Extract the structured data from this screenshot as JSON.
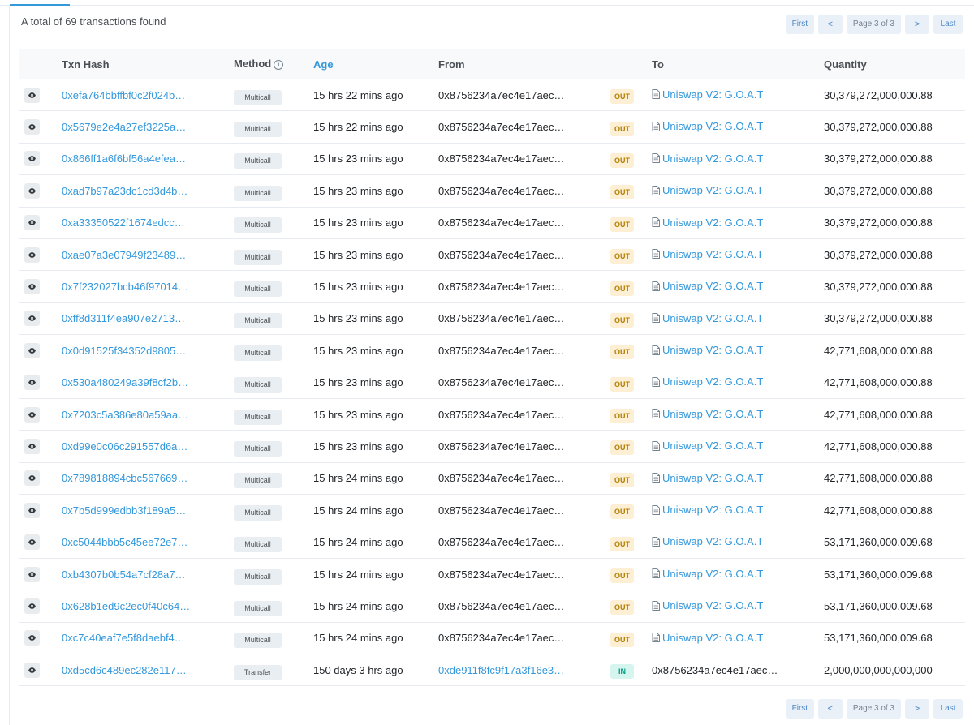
{
  "summary": "A total of 69 transactions found",
  "pager": {
    "first": "First",
    "prev": "<",
    "info": "Page 3 of 3",
    "next": ">",
    "last": "Last"
  },
  "table": {
    "headers": {
      "hash": "Txn Hash",
      "method": "Method",
      "age": "Age",
      "from": "From",
      "to": "To",
      "quantity": "Quantity"
    },
    "rows": [
      {
        "hash": "0xefa764bbffbf0c2f024b…",
        "method": "Multicall",
        "age": "15 hrs 22 mins ago",
        "from": "0x8756234a7ec4e17aec…",
        "dir": "OUT",
        "to": "Uniswap V2: G.O.A.T",
        "to_contract": true,
        "qty": "30,379,272,000,000.88"
      },
      {
        "hash": "0x5679e2e4a27ef3225a…",
        "method": "Multicall",
        "age": "15 hrs 22 mins ago",
        "from": "0x8756234a7ec4e17aec…",
        "dir": "OUT",
        "to": "Uniswap V2: G.O.A.T",
        "to_contract": true,
        "qty": "30,379,272,000,000.88"
      },
      {
        "hash": "0x866ff1a6f6bf56a4efea…",
        "method": "Multicall",
        "age": "15 hrs 23 mins ago",
        "from": "0x8756234a7ec4e17aec…",
        "dir": "OUT",
        "to": "Uniswap V2: G.O.A.T",
        "to_contract": true,
        "qty": "30,379,272,000,000.88"
      },
      {
        "hash": "0xad7b97a23dc1cd3d4b…",
        "method": "Multicall",
        "age": "15 hrs 23 mins ago",
        "from": "0x8756234a7ec4e17aec…",
        "dir": "OUT",
        "to": "Uniswap V2: G.O.A.T",
        "to_contract": true,
        "qty": "30,379,272,000,000.88"
      },
      {
        "hash": "0xa33350522f1674edcc…",
        "method": "Multicall",
        "age": "15 hrs 23 mins ago",
        "from": "0x8756234a7ec4e17aec…",
        "dir": "OUT",
        "to": "Uniswap V2: G.O.A.T",
        "to_contract": true,
        "qty": "30,379,272,000,000.88"
      },
      {
        "hash": "0xae07a3e07949f23489…",
        "method": "Multicall",
        "age": "15 hrs 23 mins ago",
        "from": "0x8756234a7ec4e17aec…",
        "dir": "OUT",
        "to": "Uniswap V2: G.O.A.T",
        "to_contract": true,
        "qty": "30,379,272,000,000.88"
      },
      {
        "hash": "0x7f232027bcb46f97014…",
        "method": "Multicall",
        "age": "15 hrs 23 mins ago",
        "from": "0x8756234a7ec4e17aec…",
        "dir": "OUT",
        "to": "Uniswap V2: G.O.A.T",
        "to_contract": true,
        "qty": "30,379,272,000,000.88"
      },
      {
        "hash": "0xff8d311f4ea907e2713…",
        "method": "Multicall",
        "age": "15 hrs 23 mins ago",
        "from": "0x8756234a7ec4e17aec…",
        "dir": "OUT",
        "to": "Uniswap V2: G.O.A.T",
        "to_contract": true,
        "qty": "30,379,272,000,000.88"
      },
      {
        "hash": "0x0d91525f34352d9805…",
        "method": "Multicall",
        "age": "15 hrs 23 mins ago",
        "from": "0x8756234a7ec4e17aec…",
        "dir": "OUT",
        "to": "Uniswap V2: G.O.A.T",
        "to_contract": true,
        "qty": "42,771,608,000,000.88"
      },
      {
        "hash": "0x530a480249a39f8cf2b…",
        "method": "Multicall",
        "age": "15 hrs 23 mins ago",
        "from": "0x8756234a7ec4e17aec…",
        "dir": "OUT",
        "to": "Uniswap V2: G.O.A.T",
        "to_contract": true,
        "qty": "42,771,608,000,000.88"
      },
      {
        "hash": "0x7203c5a386e80a59aa…",
        "method": "Multicall",
        "age": "15 hrs 23 mins ago",
        "from": "0x8756234a7ec4e17aec…",
        "dir": "OUT",
        "to": "Uniswap V2: G.O.A.T",
        "to_contract": true,
        "qty": "42,771,608,000,000.88"
      },
      {
        "hash": "0xd99e0c06c291557d6a…",
        "method": "Multicall",
        "age": "15 hrs 23 mins ago",
        "from": "0x8756234a7ec4e17aec…",
        "dir": "OUT",
        "to": "Uniswap V2: G.O.A.T",
        "to_contract": true,
        "qty": "42,771,608,000,000.88"
      },
      {
        "hash": "0x789818894cbc567669…",
        "method": "Multicall",
        "age": "15 hrs 24 mins ago",
        "from": "0x8756234a7ec4e17aec…",
        "dir": "OUT",
        "to": "Uniswap V2: G.O.A.T",
        "to_contract": true,
        "qty": "42,771,608,000,000.88"
      },
      {
        "hash": "0x7b5d999edbb3f189a5…",
        "method": "Multicall",
        "age": "15 hrs 24 mins ago",
        "from": "0x8756234a7ec4e17aec…",
        "dir": "OUT",
        "to": "Uniswap V2: G.O.A.T",
        "to_contract": true,
        "qty": "42,771,608,000,000.88"
      },
      {
        "hash": "0xc5044bbb5c45ee72e7…",
        "method": "Multicall",
        "age": "15 hrs 24 mins ago",
        "from": "0x8756234a7ec4e17aec…",
        "dir": "OUT",
        "to": "Uniswap V2: G.O.A.T",
        "to_contract": true,
        "qty": "53,171,360,000,009.68"
      },
      {
        "hash": "0xb4307b0b54a7cf28a7…",
        "method": "Multicall",
        "age": "15 hrs 24 mins ago",
        "from": "0x8756234a7ec4e17aec…",
        "dir": "OUT",
        "to": "Uniswap V2: G.O.A.T",
        "to_contract": true,
        "qty": "53,171,360,000,009.68"
      },
      {
        "hash": "0x628b1ed9c2ec0f40c64…",
        "method": "Multicall",
        "age": "15 hrs 24 mins ago",
        "from": "0x8756234a7ec4e17aec…",
        "dir": "OUT",
        "to": "Uniswap V2: G.O.A.T",
        "to_contract": true,
        "qty": "53,171,360,000,009.68"
      },
      {
        "hash": "0xc7c40eaf7e5f8daebf4…",
        "method": "Multicall",
        "age": "15 hrs 24 mins ago",
        "from": "0x8756234a7ec4e17aec…",
        "dir": "OUT",
        "to": "Uniswap V2: G.O.A.T",
        "to_contract": true,
        "qty": "53,171,360,000,009.68"
      },
      {
        "hash": "0xd5cd6c489ec282e117…",
        "method": "Transfer",
        "age": "150 days 3 hrs ago",
        "from": "0xde911f8fc9f17a3f16e3…",
        "from_link": true,
        "dir": "IN",
        "to": "0x8756234a7ec4e17aec…",
        "to_contract": false,
        "qty": "2,000,000,000,000,000"
      }
    ]
  },
  "colors": {
    "link": "#3498db",
    "out_badge": "#fcefd4",
    "in_badge": "#d5f5ee"
  },
  "icons": {
    "view": "eye-icon",
    "contract": "document-icon",
    "info": "info-circle-icon"
  }
}
